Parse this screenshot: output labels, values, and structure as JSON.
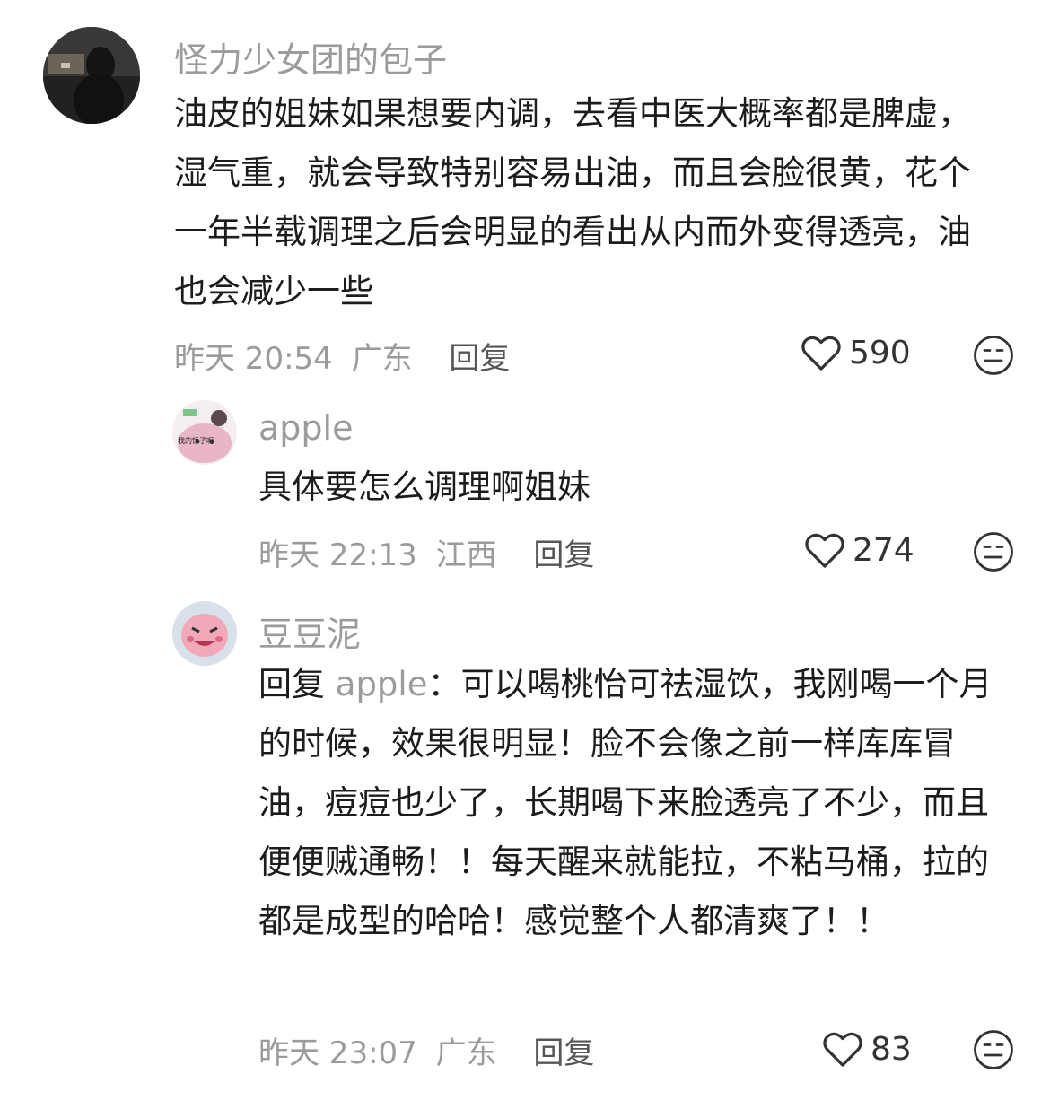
{
  "comments": [
    {
      "user": "怪力少女团的包子",
      "text": "油皮的姐妹如果想要内调，去看中医大概率都是脾虚，湿气重，就会导致特别容易出油，而且会脸很黄，花个一年半载调理之后会明显的看出从内而外变得透亮，油也会减少一些",
      "time": "昨天 20:54",
      "location": "广东",
      "reply_label": "回复",
      "likes": "590",
      "avatar_icon": "user-photo-avatar"
    },
    {
      "user": "apple",
      "text": "具体要怎么调理啊姐妹",
      "time": "昨天 22:13",
      "location": "江西",
      "reply_label": "回复",
      "likes": "274",
      "avatar_icon": "cartoon-pig-avatar",
      "avatar_text": "我的锤子呢"
    },
    {
      "user": "豆豆泥",
      "reply_prefix": "回复",
      "reply_to": "apple",
      "text": "：可以喝桃怡可祛湿饮，我刚喝一个月的时候，效果很明显！脸不会像之前一样库库冒油，痘痘也少了，长期喝下来脸透亮了不少，而且便便贼通畅！！每天醒来就能拉，不粘马桶，拉的都是成型的哈哈！感觉整个人都清爽了！！",
      "time": "昨天 23:07",
      "location": "广东",
      "reply_label": "回复",
      "likes": "83",
      "avatar_icon": "cartoon-pink-face-avatar"
    }
  ],
  "icons": {
    "like": "heart-outline-icon",
    "dislike": "meh-face-icon"
  }
}
